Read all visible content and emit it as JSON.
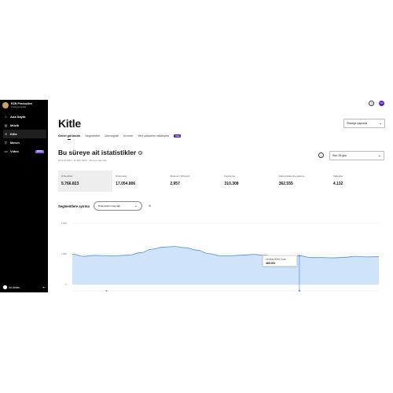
{
  "sidebar": {
    "artist_name": "RZN Produçőes",
    "artist_sub": "Profili görüntüle",
    "items": [
      {
        "label": "Ana Sayfa",
        "icon": "home-icon"
      },
      {
        "label": "Müzik",
        "icon": "music-icon"
      },
      {
        "label": "Kitle",
        "icon": "audience-icon"
      },
      {
        "label": "Merch",
        "icon": "merch-icon"
      },
      {
        "label": "Video",
        "icon": "video-icon",
        "badge": "BETA"
      }
    ],
    "footer_label": "for Artists"
  },
  "header": {
    "help_icon": "?",
    "user_initials": "RZ"
  },
  "page": {
    "title": "Kitle",
    "compare_label": "Önceye çapında"
  },
  "tabs": [
    {
      "label": "Genel görünüm",
      "active": true
    },
    {
      "label": "Segmentler"
    },
    {
      "label": "Demografi"
    },
    {
      "label": "Konum"
    },
    {
      "label": "Yeni yükselen etkileşimi"
    }
  ],
  "new_badge": "Yeni",
  "section": {
    "title": "Bu süreye ait istatistikler",
    "date_range": "24 Şub 2024 - 22 Mar 2024 · Önceye çapında",
    "period_label": "Son 28 gün"
  },
  "metrics": [
    {
      "label": "Dinleyiciler",
      "value": "5.766.823"
    },
    {
      "label": "Dinlemeler",
      "value": "17.054.806"
    },
    {
      "label": "Dinleme / Dinleyici",
      "value": "2,957"
    },
    {
      "label": "Kaydetme",
      "value": "310.308"
    },
    {
      "label": "Çalma listelerine ekleme",
      "value": "362.555"
    },
    {
      "label": "Takipçiler",
      "value": "4.132"
    }
  ],
  "segments": {
    "label": "Segmentlere ayırma",
    "select_label": "Dinlemelerin kaynağı",
    "or_label": "ile"
  },
  "tooltip": {
    "date": "16 Mar 2024 Cum",
    "value": "465.091"
  },
  "chart_data": {
    "type": "area",
    "y_ticks": [
      "1.000.000",
      "500.000",
      "0"
    ],
    "ylim": [
      0,
      1000000
    ],
    "values": [
      495000,
      460000,
      475000,
      470000,
      470000,
      480000,
      520000,
      575000,
      610000,
      620000,
      600000,
      560000,
      505000,
      470000,
      470000,
      480000,
      490000,
      475000,
      445000,
      465000,
      470000,
      440000,
      440000,
      435000,
      445000,
      460000,
      450000,
      455000
    ],
    "selected_index": 20,
    "colors": {
      "fill": "#cfe3fb",
      "line": "#4f8fe0"
    }
  }
}
